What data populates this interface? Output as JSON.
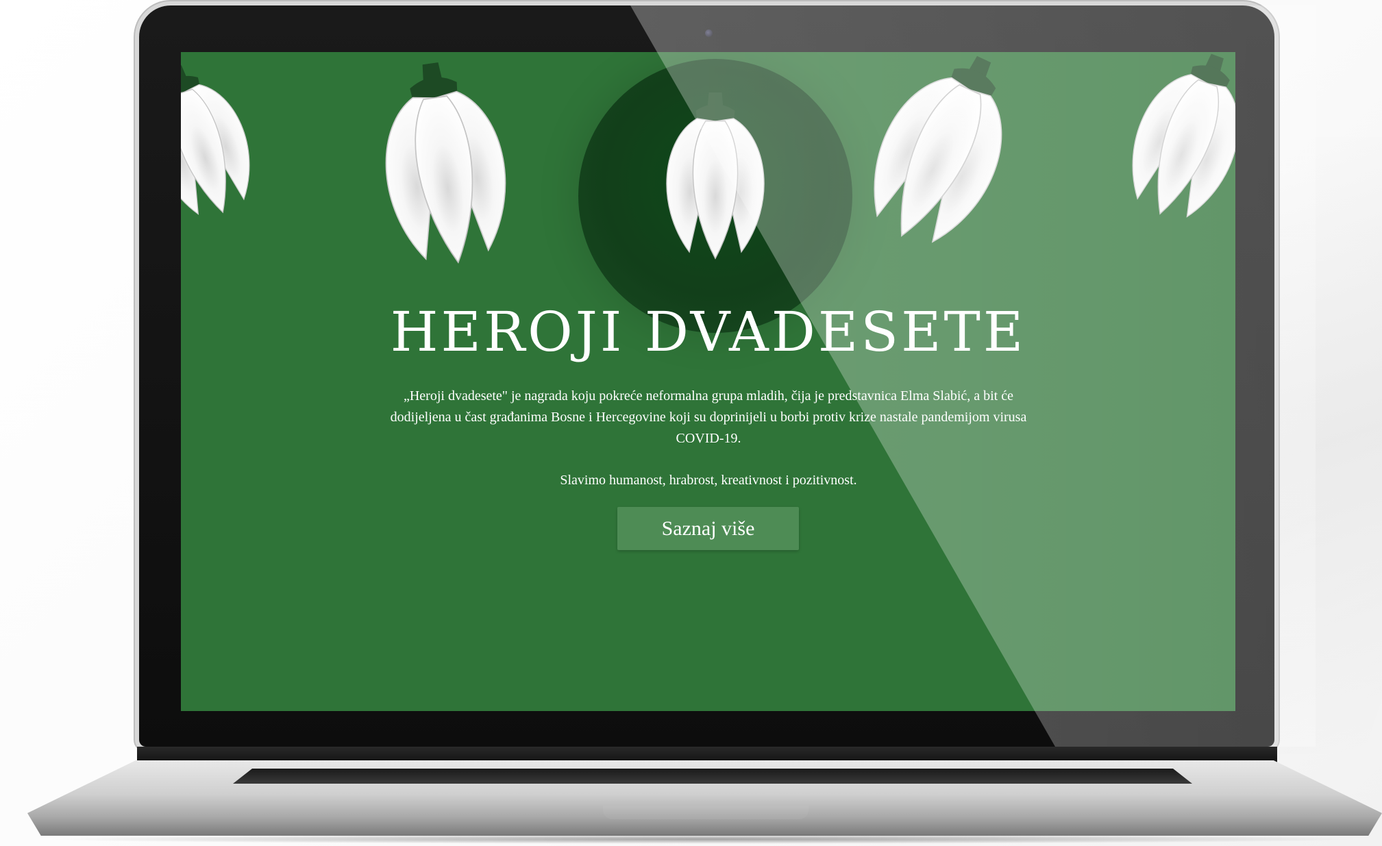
{
  "hero": {
    "title": "HEROJI DVADESETE",
    "description": "„Heroji dvadesete\" je nagrada koju pokreće neformalna grupa mladih, čija je predstavnica Elma Slabić, a bit će dodijeljena u čast građanima Bosne i Hercegovine koji su doprinijeli u borbi protiv krize nastale pandemijom virusa COVID-19.",
    "tagline": "Slavimo humanost, hrabrost, kreativnost i pozitivnost.",
    "cta_label": "Saznaj više"
  },
  "icons": {
    "flower": "snowdrop-icon"
  },
  "colors": {
    "screen_background": "#2f7438",
    "button_background": "#4e8c55",
    "highlight_circle": "#123f1a",
    "text": "#ffffff"
  }
}
